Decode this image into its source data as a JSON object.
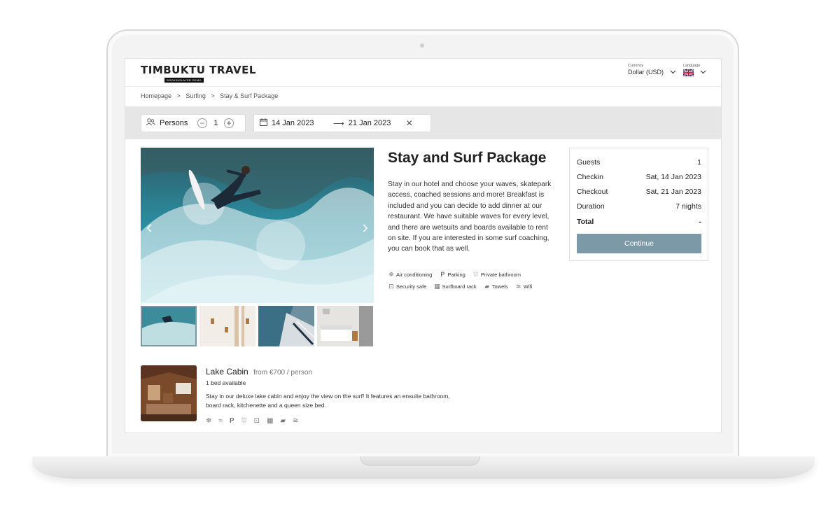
{
  "header": {
    "logo_text": "TIMBUKTU TRAVEL",
    "logo_badge": "BOOKINGLAYER DEMO",
    "currency_caption": "Currency",
    "currency_value": "Dollar (USD)",
    "language_caption": "Language"
  },
  "breadcrumb": [
    "Homepage",
    ">",
    "Surfing",
    ">",
    "Stay & Surf Package"
  ],
  "search": {
    "persons_label": "Persons",
    "persons_count": "1",
    "checkin": "14 Jan 2023",
    "checkout": "21 Jan 2023"
  },
  "package": {
    "title": "Stay and Surf Package",
    "description": "Stay in our hotel and choose your waves, skatepark access, coached sessions and more! Breakfast is included and you can decide to add dinner at our restaurant. We have suitable waves for every level, and there are wetsuits and boards available to rent on site. If you are interested in some surf coaching, you can book that as well.",
    "amenities": [
      {
        "icon": "snowflake-icon",
        "glyph": "❄",
        "label": "Air conditioning"
      },
      {
        "icon": "parking-icon",
        "glyph": "P",
        "label": "Parking"
      },
      {
        "icon": "shower-icon",
        "glyph": "⛆",
        "label": "Private bathroom"
      },
      {
        "icon": "safe-icon",
        "glyph": "⊡",
        "label": "Security safe"
      },
      {
        "icon": "surfboard-rack-icon",
        "glyph": "▦",
        "label": "Surfboard rack"
      },
      {
        "icon": "towel-icon",
        "glyph": "▰",
        "label": "Towels"
      },
      {
        "icon": "wifi-icon",
        "glyph": "≋",
        "label": "Wifi"
      }
    ]
  },
  "summary": {
    "guests_label": "Guests",
    "guests_value": "1",
    "checkin_label": "Checkin",
    "checkin_value": "Sat, 14 Jan 2023",
    "checkout_label": "Checkout",
    "checkout_value": "Sat, 21 Jan 2023",
    "duration_label": "Duration",
    "duration_value": "7 nights",
    "total_label": "Total",
    "total_value": "-",
    "continue_label": "Continue"
  },
  "room": {
    "name": "Lake Cabin",
    "price": "from €700 / person",
    "beds": "1 bed available",
    "description": "Stay in our deluxe lake cabin and enjoy the view on the surf! It features an ensuite bathroom, board rack, kitchenette and a queen size bed."
  },
  "colors": {
    "accent": "#7c99a8",
    "search_bg": "#e6e6e6"
  }
}
